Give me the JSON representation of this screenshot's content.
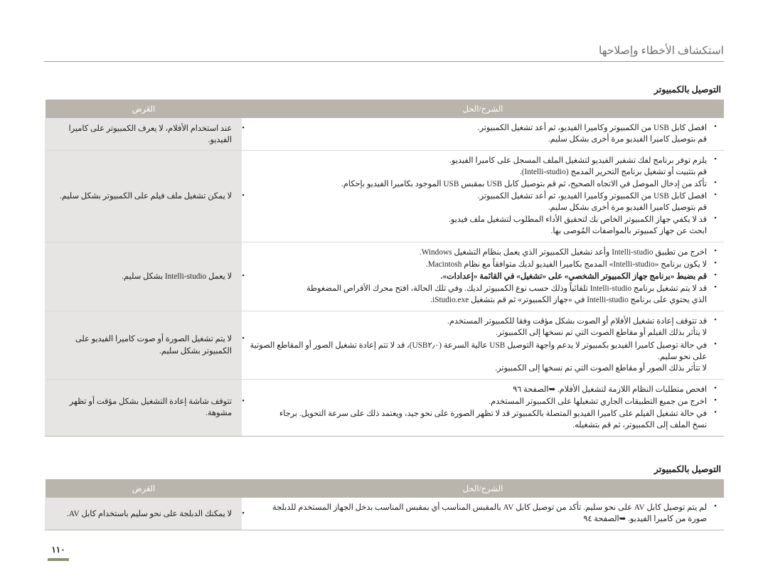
{
  "header": {
    "title": "استكشاف الأخطاء وإصلاحها"
  },
  "page_number": "١١٠",
  "tables": [
    {
      "section_title": "التوصيل بالكمبيوتر",
      "columns": {
        "symptom": "العَرض",
        "solution": "الشرح/الحل"
      },
      "rows": [
        {
          "symptom": "عند استخدام الأفلام، لا يعرف الكمبيوتر على كاميرا الفيديو.",
          "solutions": [
            {
              "main": "افصل كابل USB من الكمبيوتر وكاميرا الفيديو، ثم أعد تشغيل الكمبيوتر.",
              "sub": "قم بتوصيل كاميرا الفيديو مرة أخرى بشكل سليم."
            }
          ]
        },
        {
          "symptom": "لا يمكن تشغيل ملف فيلم على الكمبيوتر بشكل سليم.",
          "solutions": [
            {
              "main": "يلزم توفر برنامج لفك تشفير الفيديو لتشغيل الملف المسجل على كاميرا الفيديو.",
              "sub": "قم بتثبيت أو تشغيل برنامج التحرير المدمج (Intelli-studio)."
            },
            {
              "main": "تأكد من إدخال الموصل في الاتجاه الصحيح، ثم قم بتوصيل كابل USB بمقبس USB الموجود بكاميرا الفيديو بإحكام.",
              "sub": ""
            },
            {
              "main": "افصل كابل USB من الكمبيوتر وكاميرا الفيديو، ثم أعد تشغيل الكمبيوتر.",
              "sub": "قم بتوصيل كاميرا الفيديو مرة أخرى بشكل سليم."
            },
            {
              "main": "قد لا يكفي جهاز الكمبيوتر الخاص بك لتحقيق الأداء المطلوب لتشغيل ملف فيديو.",
              "sub": "ابحث عن جهاز كمبيوتر بالمواصفات المُوصى بها."
            }
          ]
        },
        {
          "symptom": "لا يعمل Intelli-studio بشكل سليم.",
          "solutions": [
            {
              "main": "اخرج من تطبيق Intelli-studio وأعد تشغيل الكمبيوتر الذي يعمل بنظام التشغيل Windows.",
              "sub": ""
            },
            {
              "main": "لا يكون برنامج «Intelli-studio» المدمج بكاميرا الفيديو لديك متوافقاً مع نظام Macintosh.",
              "sub": ""
            },
            {
              "main": "قم بضبط «برنامج جهاز الكمبيوتر الشخصي» على «تشغيل» في القائمة «إعدادات».",
              "sub": "",
              "bold_segments": [
                "«برنامج جهاز الكمبيوتر الشخصي»",
                "«تشغيل»",
                "«إعدادات»"
              ]
            },
            {
              "main": "قد لا يتم تشغيل برنامج Intelli-studio تلقائياً وذلك حسب نوع الكمبيوتر لديك. وفي تلك الحالة، افتح محرك الأقراص المضغوطة",
              "sub": "الذي يحتوي على برنامج Intelli-studio في «جهاز الكمبيوتر» ثم قم بتشغيل iStudio.exe."
            }
          ]
        },
        {
          "symptom": "لا يتم تشغيل الصورة أو صوت كاميرا الفيديو على الكمبيوتر بشكل سليم.",
          "solutions": [
            {
              "main": "قد تتوقف إعادة تشغيل الأفلام أو الصوت بشكل مؤقت وفقا للكمبيوتر المستخدم.",
              "sub": "لا يتأثر بذلك الفيلم أو مقاطع الصوت التي تم نسخها إلى الكمبيوتر."
            },
            {
              "main": "في حالة توصيل كاميرا الفيديو بكمبيوتر لا يدعم واجهة التوصيل USB عالية السرعة (USB٢٫٠)، قد لا تتم إعادة تشغيل الصور أو المقاطع الصوتية على نحو سليم.",
              "sub": "لا تتأثر بذلك الصور أو مقاطع الصوت التي تم نسخها إلى الكمبيوتر."
            }
          ]
        },
        {
          "symptom": "تتوقف شاشة إعادة التشغيل بشكل مؤقت أو تظهر مشوهة.",
          "solutions": [
            {
              "main": "افحص متطلبات النظام اللازمة لتشغيل الأفلام. ➥الصفحة ٩٦",
              "sub": ""
            },
            {
              "main": "اخرج من جميع التطبيقات الجاري تشغيلها على الكمبيوتر المستخدم.",
              "sub": ""
            },
            {
              "main": "في حالة تشغيل الفيلم على كاميرا الفيديو المتصلة بالكمبيوتر قد لا تظهر الصورة على نحو جيد، ويعتمد ذلك على سرعة التحويل. برجاء",
              "sub": "نسخ الملف إلى الكمبيوتر، ثم قم بتشغيله."
            }
          ]
        }
      ]
    },
    {
      "section_title": "التوصيل بالكمبيوتر",
      "columns": {
        "symptom": "العَرض",
        "solution": "الشرح/الحل"
      },
      "rows": [
        {
          "symptom": "لا يمكنك الدبلجة على نحو سليم باستخدام كابل AV.",
          "solutions": [
            {
              "main": "لم يتم توصيل كابل AV على نحو سليم. تأكد من توصيل كابل AV بالمقبس المناسب أي بمقبس المناسب بدخل الجهاز المستخدم للدبلجة",
              "sub": "صورة من كاميرا الفيديو. ➥الصفحة ٩٤"
            }
          ]
        }
      ]
    }
  ]
}
